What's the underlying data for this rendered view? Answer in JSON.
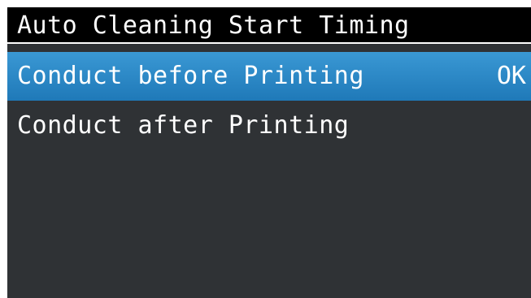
{
  "header": {
    "title": "Auto Cleaning Start Timing"
  },
  "menu": {
    "items": [
      {
        "label": "Conduct before Printing",
        "status": "OK",
        "selected": true
      },
      {
        "label": "Conduct after Printing",
        "status": "",
        "selected": false
      }
    ]
  },
  "colors": {
    "background": "#2f3235",
    "title_bar": "#000000",
    "selection": "#2e8bc9",
    "text": "#ffffff"
  }
}
